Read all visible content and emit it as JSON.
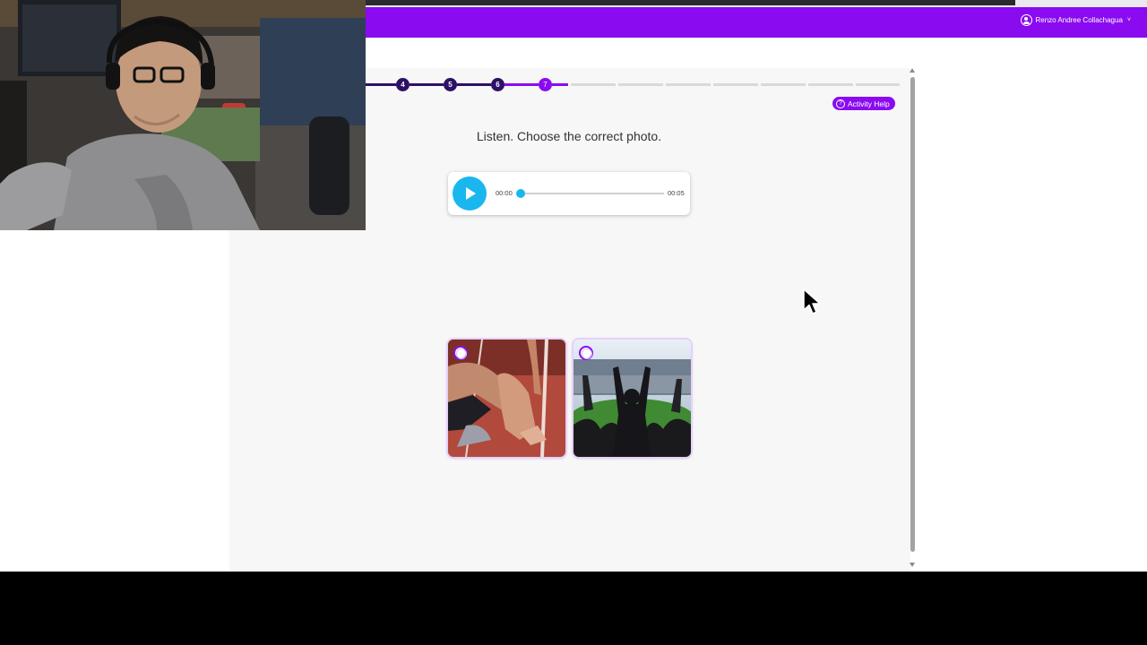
{
  "header": {
    "user_name": "Renzo Andree Collachagua",
    "brand_color": "#8a0bf0"
  },
  "progress": {
    "steps_visible": [
      "4",
      "5",
      "6",
      "7"
    ],
    "current_step": "7"
  },
  "activity_help": {
    "label": "Activity Help",
    "icon": "help-circle-icon"
  },
  "instruction": "Listen. Choose the correct photo.",
  "audio_player": {
    "current_time": "00:00",
    "duration": "00:05",
    "played_fraction": 0,
    "accent_color": "#1ab7ef"
  },
  "choices": [
    {
      "id": "choice-1",
      "image": "track-start-photo",
      "selected": false
    },
    {
      "id": "choice-2",
      "image": "stadium-fans-photo",
      "selected": false
    }
  ]
}
